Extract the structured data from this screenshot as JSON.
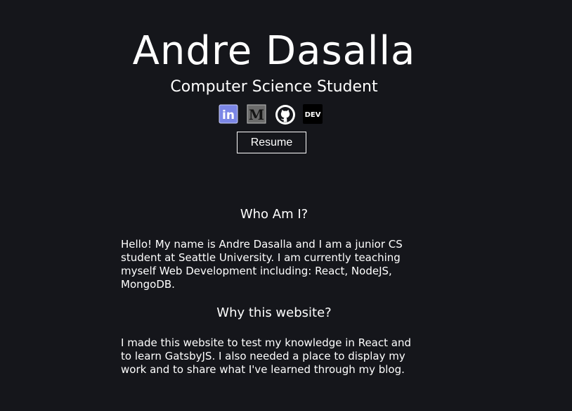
{
  "header": {
    "name": "Andre Dasalla",
    "subtitle": "Computer Science Student"
  },
  "socials": [
    {
      "name": "linkedin",
      "icon": "linkedin-icon",
      "text": "in"
    },
    {
      "name": "medium",
      "icon": "medium-icon",
      "text": "M"
    },
    {
      "name": "github",
      "icon": "github-icon"
    },
    {
      "name": "dev",
      "icon": "dev-icon",
      "text": "DEV"
    }
  ],
  "resume_label": "Resume",
  "about": {
    "heading": "Who Am I?",
    "text": "Hello! My name is Andre Dasalla and I am a junior CS student at Seattle University. I am currently teaching myself Web Development including: React, NodeJS, MongoDB."
  },
  "why": {
    "heading": "Why this website?",
    "text": "I made this website to test my knowledge in React and to learn GatsbyJS. I also needed a place to display my work and to share what I've learned through my blog."
  },
  "colors": {
    "background": "#15161b",
    "text": "#ffffff",
    "linkedin": "#7b86e6",
    "medium": "#6b6b6b",
    "dev": "#000000"
  }
}
